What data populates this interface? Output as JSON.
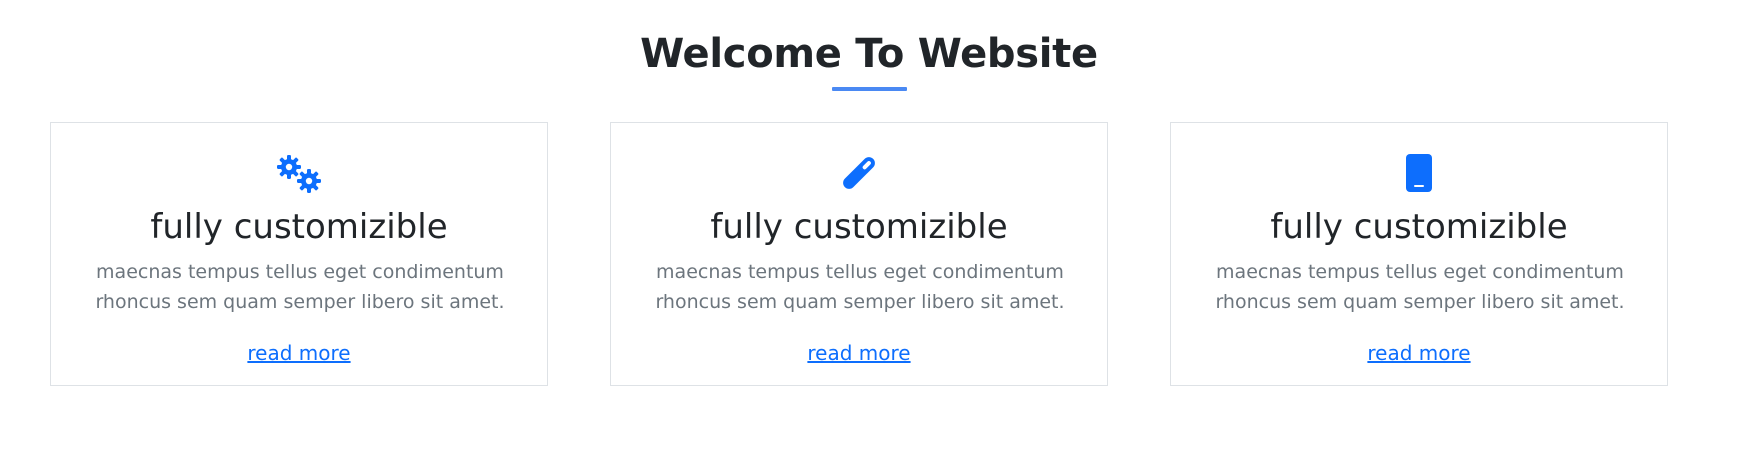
{
  "header": {
    "title": "Welcome To Website"
  },
  "colors": {
    "accent": "#0d6efd",
    "underline": "#4a89f3",
    "text_muted": "#6c757d",
    "border": "#dee2e6"
  },
  "cards": [
    {
      "icon": "gears-icon",
      "title": "fully customizible",
      "text": "maecnas tempus tellus eget condimentum rhoncus sem quam semper libero sit amet.",
      "link_label": "read more"
    },
    {
      "icon": "pencil-icon",
      "title": "fully customizible",
      "text": "maecnas tempus tellus eget condimentum rhoncus sem quam semper libero sit amet.",
      "link_label": "read more"
    },
    {
      "icon": "mobile-phone-icon",
      "title": "fully customizible",
      "text": "maecnas tempus tellus eget condimentum rhoncus sem quam semper libero sit amet.",
      "link_label": "read more"
    }
  ]
}
